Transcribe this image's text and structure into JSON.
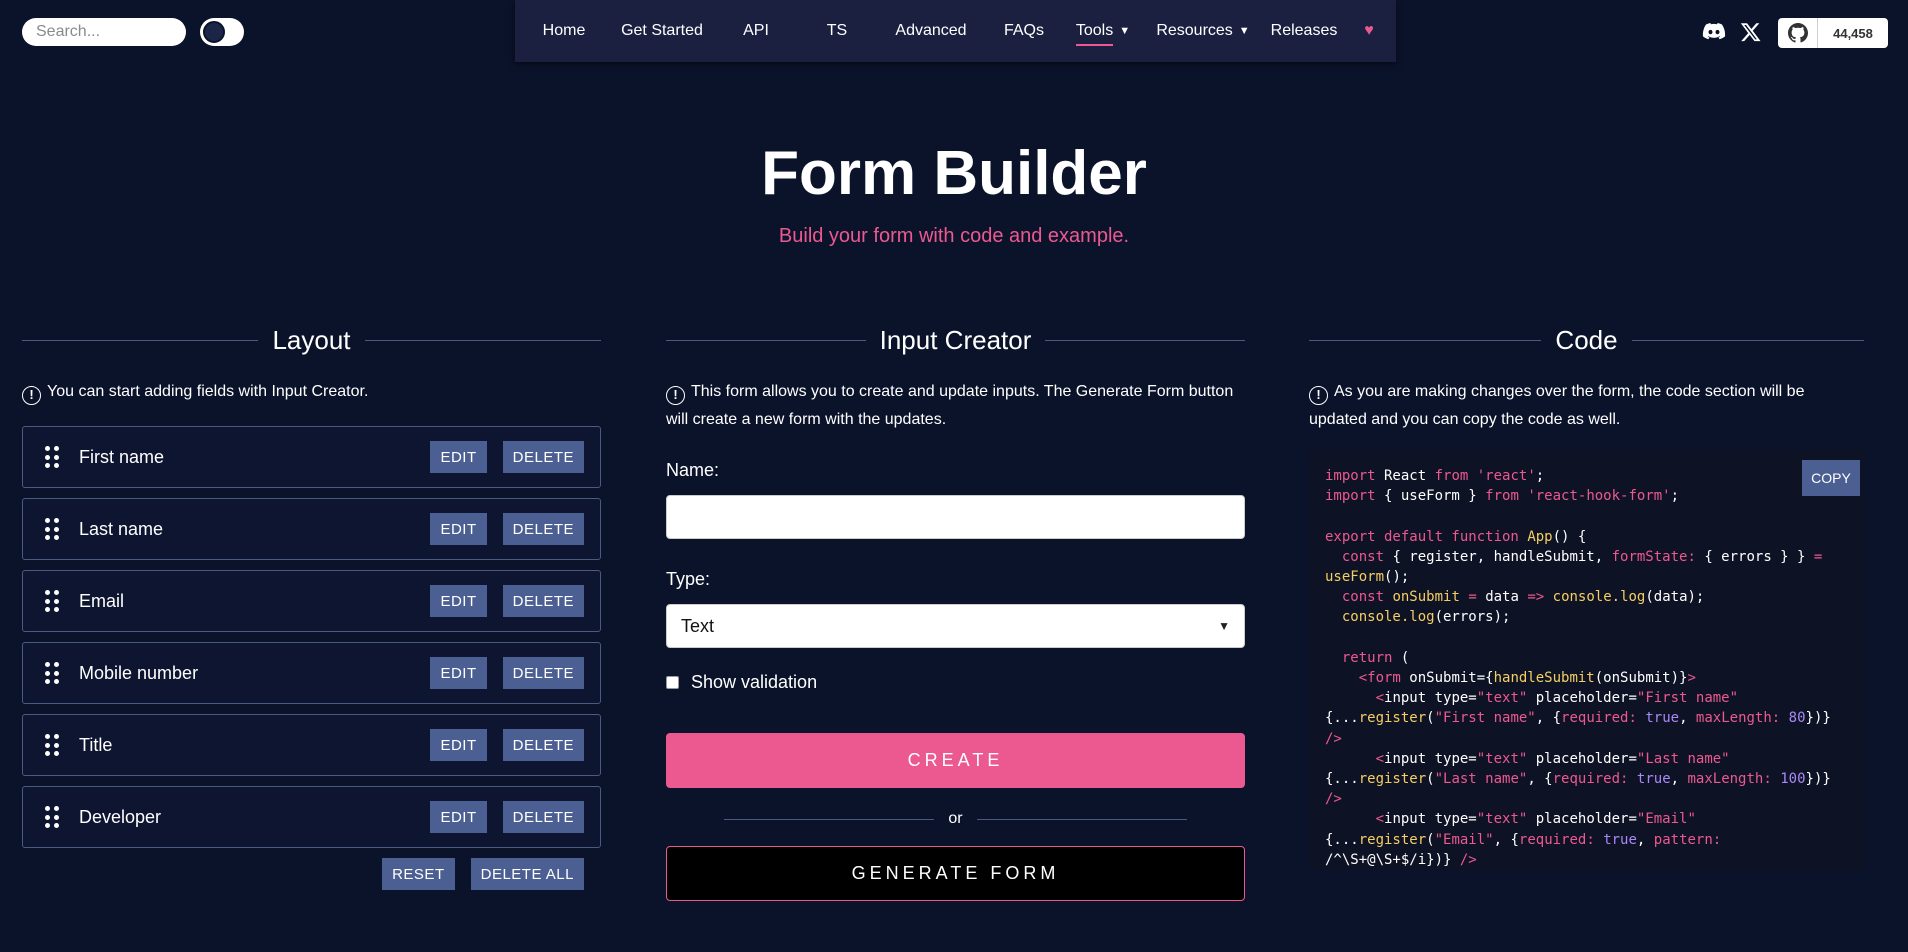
{
  "search": {
    "placeholder": "Search..."
  },
  "nav": {
    "items": [
      {
        "label": "Home"
      },
      {
        "label": "Get Started"
      },
      {
        "label": "API"
      },
      {
        "label": "TS"
      },
      {
        "label": "Advanced"
      },
      {
        "label": "FAQs"
      },
      {
        "label": "Tools",
        "dropdown": true,
        "active": true
      },
      {
        "label": "Resources",
        "dropdown": true
      },
      {
        "label": "Releases"
      }
    ],
    "heart_icon": "heart-icon"
  },
  "social": {
    "discord_icon": "discord-icon",
    "x_icon": "x-icon",
    "github_icon": "github-icon",
    "github_stars": "44,458"
  },
  "hero": {
    "title": "Form Builder",
    "subtitle": "Build your form with code and example."
  },
  "layout": {
    "title": "Layout",
    "info": "You can start adding fields with Input Creator.",
    "fields": [
      {
        "name": "First name"
      },
      {
        "name": "Last name"
      },
      {
        "name": "Email"
      },
      {
        "name": "Mobile number"
      },
      {
        "name": "Title"
      },
      {
        "name": "Developer"
      }
    ],
    "edit_label": "EDIT",
    "delete_label": "DELETE",
    "reset_label": "RESET",
    "delete_all_label": "DELETE ALL"
  },
  "creator": {
    "title": "Input Creator",
    "info": "This form allows you to create and update inputs. The Generate Form button will create a new form with the updates.",
    "name_label": "Name:",
    "name_value": "",
    "type_label": "Type:",
    "type_value": "Text",
    "show_validation_label": "Show validation",
    "show_validation_checked": false,
    "create_label": "CREATE",
    "or_label": "or",
    "generate_label": "GENERATE FORM"
  },
  "code": {
    "title": "Code",
    "info": "As you are making changes over the form, the code section will be updated and you can copy the code as well.",
    "copy_label": "COPY"
  },
  "colors": {
    "background": "#0b132a",
    "accent": "#ec5990",
    "button": "#4c5f92",
    "nav_bg": "#1b2040"
  }
}
